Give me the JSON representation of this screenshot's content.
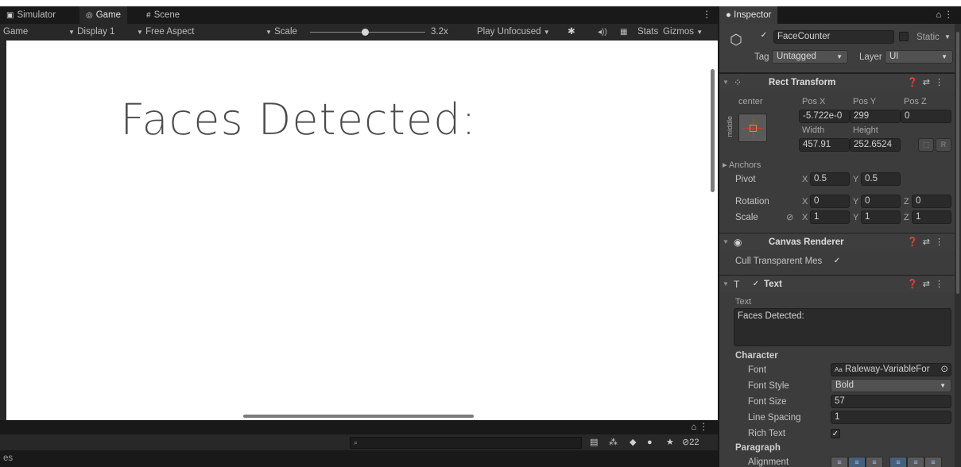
{
  "tabs": {
    "simulator": "Simulator",
    "game": "Game",
    "scene": "Scene"
  },
  "game_toolbar": {
    "mode": "Game",
    "display": "Display 1",
    "aspect": "Free Aspect",
    "scale_label": "Scale",
    "scale_value": "3.2x",
    "play_mode": "Play Unfocused",
    "stats": "Stats",
    "gizmos": "Gizmos"
  },
  "game_view": {
    "display_text": "Faces Detected:"
  },
  "console": {
    "search_placeholder": "",
    "hidden_count": "22",
    "status_text": "es"
  },
  "inspector": {
    "tab_label": "Inspector",
    "object_name": "FaceCounter",
    "static_label": "Static",
    "tag_label": "Tag",
    "tag_value": "Untagged",
    "layer_label": "Layer",
    "layer_value": "UI",
    "rect_transform": {
      "title": "Rect Transform",
      "anchor_h": "center",
      "anchor_v": "middle",
      "pos_x_label": "Pos X",
      "pos_y_label": "Pos Y",
      "pos_z_label": "Pos Z",
      "pos_x": "-5.722e-0",
      "pos_y": "299",
      "pos_z": "0",
      "width_label": "Width",
      "height_label": "Height",
      "width": "457.91",
      "height": "252.6524",
      "r_label": "R",
      "anchors_label": "Anchors",
      "pivot_label": "Pivot",
      "pivot_x": "0.5",
      "pivot_y": "0.5",
      "rotation_label": "Rotation",
      "rot_x": "0",
      "rot_y": "0",
      "rot_z": "0",
      "scale_label": "Scale",
      "scale_x": "1",
      "scale_y": "1",
      "scale_z": "1",
      "x": "X",
      "y": "Y",
      "z": "Z"
    },
    "canvas_renderer": {
      "title": "Canvas Renderer",
      "cull_label": "Cull Transparent Mes"
    },
    "text_component": {
      "title": "Text",
      "text_label": "Text",
      "text_value": "Faces Detected:",
      "character_label": "Character",
      "font_label": "Font",
      "font_value": "Raleway-VariableFor",
      "font_style_label": "Font Style",
      "font_style_value": "Bold",
      "font_size_label": "Font Size",
      "font_size_value": "57",
      "line_spacing_label": "Line Spacing",
      "line_spacing_value": "1",
      "rich_text_label": "Rich Text",
      "paragraph_label": "Paragraph",
      "alignment_label": "Alignment"
    }
  }
}
